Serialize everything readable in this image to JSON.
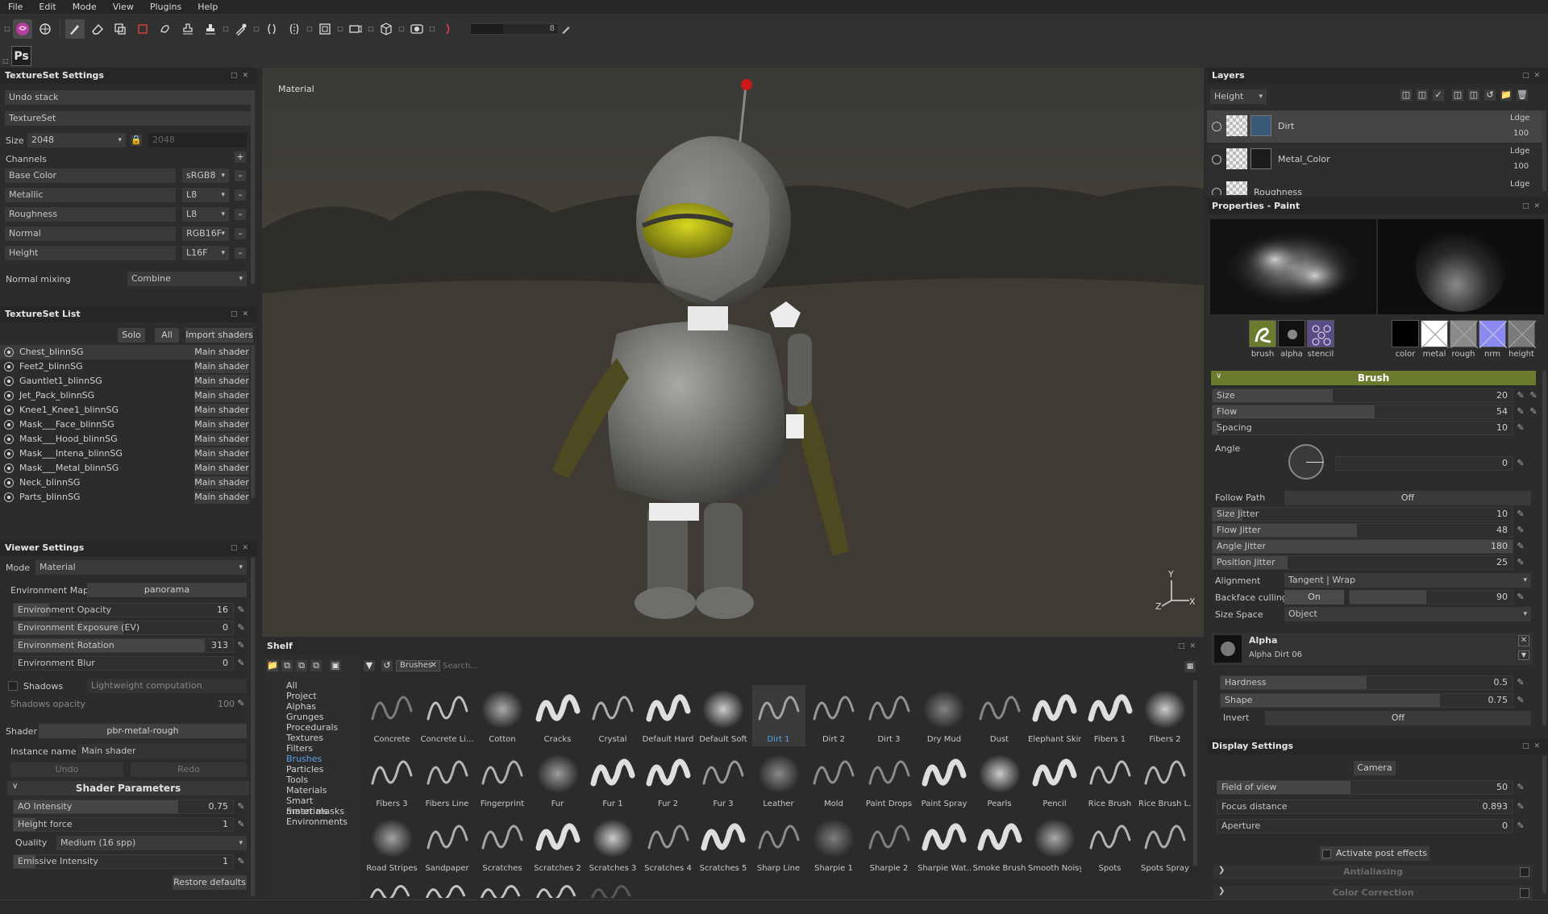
{
  "menu": [
    "File",
    "Edit",
    "Mode",
    "View",
    "Plugins",
    "Help"
  ],
  "toolbar": {
    "tools": [
      "logo-icon",
      "sync-icon",
      "paint-brush-icon",
      "eraser-icon",
      "projection-icon",
      "polygon-fill-icon",
      "smudge-icon",
      "clone-stamp-icon",
      "clone-stamp-alt-icon",
      "picker-icon",
      "symmetry-icon",
      "symmetry-mirror-icon",
      "camera-2d-icon",
      "viewport-icon",
      "camera-icon",
      "cube-icon",
      "render-icon",
      "tone-icon"
    ],
    "slider_value": "8",
    "ps_label": "Ps"
  },
  "textureset_settings": {
    "title": "TextureSet Settings",
    "undo_stack": "Undo stack",
    "textureset_label": "TextureSet",
    "size_label": "Size",
    "size_value": "2048",
    "size_value2": "2048",
    "channels_label": "Channels",
    "channels": [
      {
        "name": "Base Color",
        "format": "sRGB8"
      },
      {
        "name": "Metallic",
        "format": "L8"
      },
      {
        "name": "Roughness",
        "format": "L8"
      },
      {
        "name": "Normal",
        "format": "RGB16F"
      },
      {
        "name": "Height",
        "format": "L16F"
      }
    ],
    "normal_mixing_label": "Normal mixing",
    "normal_mixing_value": "Combine"
  },
  "textureset_list": {
    "title": "TextureSet List",
    "solo": "Solo",
    "all": "All",
    "import_shaders": "Import shaders",
    "items": [
      {
        "name": "Chest_blinnSG",
        "shader": "Main shader"
      },
      {
        "name": "Feet2_blinnSG",
        "shader": "Main shader"
      },
      {
        "name": "Gauntlet1_blinnSG",
        "shader": "Main shader"
      },
      {
        "name": "Jet_Pack_blinnSG",
        "shader": "Main shader"
      },
      {
        "name": "Knee1_Knee1_blinnSG",
        "shader": "Main shader"
      },
      {
        "name": "Mask___Face_blinnSG",
        "shader": "Main shader"
      },
      {
        "name": "Mask___Hood_blinnSG",
        "shader": "Main shader"
      },
      {
        "name": "Mask___Intena_blinnSG",
        "shader": "Main shader"
      },
      {
        "name": "Mask___Metal_blinnSG",
        "shader": "Main shader"
      },
      {
        "name": "Neck_blinnSG",
        "shader": "Main shader"
      },
      {
        "name": "Parts_blinnSG",
        "shader": "Main shader"
      }
    ]
  },
  "viewer_settings": {
    "title": "Viewer Settings",
    "mode_label": "Mode",
    "mode_value": "Material",
    "env_map_label": "Environment Map",
    "env_map_value": "panorama",
    "sliders": [
      {
        "name": "Environment Opacity",
        "value": "16",
        "level": 0.16
      },
      {
        "name": "Environment Exposure (EV)",
        "value": "0",
        "level": 0.5
      },
      {
        "name": "Environment Rotation",
        "value": "313",
        "level": 0.87
      },
      {
        "name": "Environment Blur",
        "value": "0",
        "level": 0.0
      }
    ],
    "shadows_label": "Shadows",
    "shadows_mode": "Lightweight computation",
    "shadows_opacity_label": "Shadows opacity",
    "shadows_opacity_value": "100",
    "shader_label": "Shader",
    "shader_value": "pbr-metal-rough",
    "instance_label": "Instance name",
    "instance_value": "Main shader",
    "undo": "Undo",
    "redo": "Redo",
    "shader_params_title": "Shader Parameters",
    "ao_label": "AO Intensity",
    "ao_value": "0.75",
    "ao_level": 0.75,
    "height_label": "Height force",
    "height_value": "1",
    "height_level": 0.1,
    "quality_label": "Quality",
    "quality_value": "Medium (16 spp)",
    "emissive_label": "Emissive Intensity",
    "emissive_value": "1",
    "emissive_level": 0.1,
    "restore_defaults": "Restore defaults"
  },
  "viewport": {
    "label": "Material",
    "axis_y": "Y",
    "axis_z": "Z",
    "axis_x": "X"
  },
  "shelf": {
    "title": "Shelf",
    "filter_tag": "Brushes",
    "search_placeholder": "Search...",
    "categories": [
      "All",
      "Project",
      "Alphas",
      "Grunges",
      "Procedurals",
      "Textures",
      "Filters",
      "Brushes",
      "Particles",
      "Tools",
      "Materials",
      "Smart materials",
      "Smart masks",
      "Environments"
    ],
    "selected_category": "Brushes",
    "brushes": [
      "Concrete",
      "Concrete Li...",
      "Cotton",
      "Cracks",
      "Crystal",
      "Default Hard",
      "Default Soft",
      "Dirt 1",
      "Dirt 2",
      "Dirt 3",
      "Dry Mud",
      "Dust",
      "Elephant Skin",
      "Fibers 1",
      "Fibers 2",
      "Fibers 3",
      "Fibers Line",
      "Fingerprint",
      "Fur",
      "Fur 1",
      "Fur 2",
      "Fur 3",
      "Leather",
      "Mold",
      "Paint Drops",
      "Paint Spray",
      "Pearls",
      "Pencil",
      "Rice Brush",
      "Rice Brush L...",
      "Road Stripes",
      "Sandpaper",
      "Scratches",
      "Scratches 2",
      "Scratches 3",
      "Scratches 4",
      "Scratches 5",
      "Sharp Line",
      "Sharpie 1",
      "Sharpie 2",
      "Sharpie Wat...",
      "Smoke Brush",
      "Smooth Noisy",
      "Spots",
      "Spots Spray"
    ],
    "selected_brush": "Dirt 1"
  },
  "layers": {
    "title": "Layers",
    "blend_mode": "Height",
    "items": [
      {
        "name": "Dirt",
        "blend": "Ldge",
        "opacity": "100"
      },
      {
        "name": "Metal_Color",
        "blend": "Ldge",
        "opacity": "100"
      },
      {
        "name": "Roughness",
        "blend": "Ldge",
        "opacity": ""
      }
    ]
  },
  "properties": {
    "title": "Properties - Paint",
    "brush_chips": [
      "brush",
      "alpha",
      "stencil"
    ],
    "material_chips": [
      "color",
      "metal",
      "rough",
      "nrm",
      "height"
    ],
    "brush_section": "Brush",
    "sliders": [
      {
        "name": "Size",
        "value": "20",
        "level": 0.4
      },
      {
        "name": "Flow",
        "value": "54",
        "level": 0.54
      },
      {
        "name": "Spacing",
        "value": "10",
        "level": 0.02
      }
    ],
    "angle_label": "Angle",
    "angle_value": "0",
    "follow_path_label": "Follow Path",
    "follow_path_value": "Off",
    "jitters": [
      {
        "name": "Size Jitter",
        "value": "10",
        "level": 0.1
      },
      {
        "name": "Flow Jitter",
        "value": "48",
        "level": 0.48
      },
      {
        "name": "Angle Jitter",
        "value": "180",
        "level": 1.0
      },
      {
        "name": "Position Jitter",
        "value": "25",
        "level": 0.25
      }
    ],
    "alignment_label": "Alignment",
    "alignment_value": "Tangent | Wrap",
    "backface_label": "Backface culling",
    "backface_toggle": "On",
    "backface_value": "90",
    "backface_level": 0.47,
    "size_space_label": "Size Space",
    "size_space_value": "Object",
    "alpha_title": "Alpha",
    "alpha_name": "Alpha Dirt 06",
    "hardness_label": "Hardness",
    "hardness_value": "0.5",
    "hardness_level": 0.5,
    "shape_label": "Shape",
    "shape_value": "0.75",
    "shape_level": 0.75,
    "invert_label": "Invert",
    "invert_value": "Off"
  },
  "display_settings": {
    "title": "Display Settings",
    "camera": "Camera",
    "sliders": [
      {
        "name": "Field of view",
        "value": "50",
        "level": 0.45
      },
      {
        "name": "Focus distance",
        "value": "0.893",
        "level": 0.0
      },
      {
        "name": "Aperture",
        "value": "0",
        "level": 0.0
      }
    ],
    "post_effects": "Activate post effects",
    "antialiasing": "Antialiasing",
    "color_correction": "Color Correction"
  },
  "colors": {
    "accent_green": "#6b7b2e",
    "selection_blue": "#5aa0e6",
    "panel_bg": "#2c2c2c"
  }
}
